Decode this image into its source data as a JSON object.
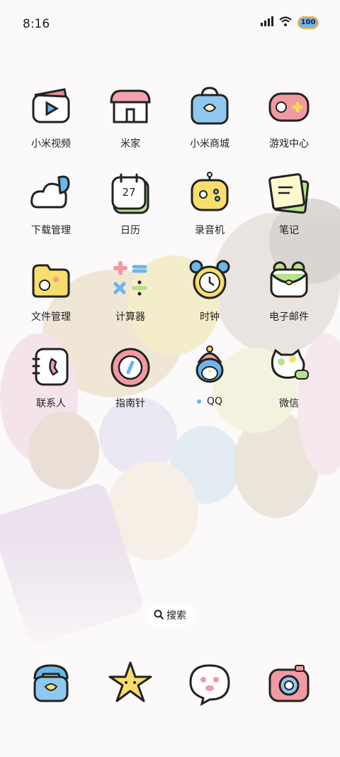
{
  "status": {
    "time": "8:16",
    "battery": "100"
  },
  "apps": [
    {
      "label": "小米视频"
    },
    {
      "label": "米家"
    },
    {
      "label": "小米商城"
    },
    {
      "label": "游戏中心"
    },
    {
      "label": "下载管理"
    },
    {
      "label": "日历",
      "date": "27"
    },
    {
      "label": "录音机"
    },
    {
      "label": "笔记"
    },
    {
      "label": "文件管理"
    },
    {
      "label": "计算器"
    },
    {
      "label": "时钟"
    },
    {
      "label": "电子邮件"
    },
    {
      "label": "联系人"
    },
    {
      "label": "指南针"
    },
    {
      "label": "QQ"
    },
    {
      "label": "微信"
    }
  ],
  "search": {
    "label": "搜索"
  },
  "dock": [
    {
      "name": "phone"
    },
    {
      "name": "star-app"
    },
    {
      "name": "messages"
    },
    {
      "name": "camera"
    }
  ]
}
